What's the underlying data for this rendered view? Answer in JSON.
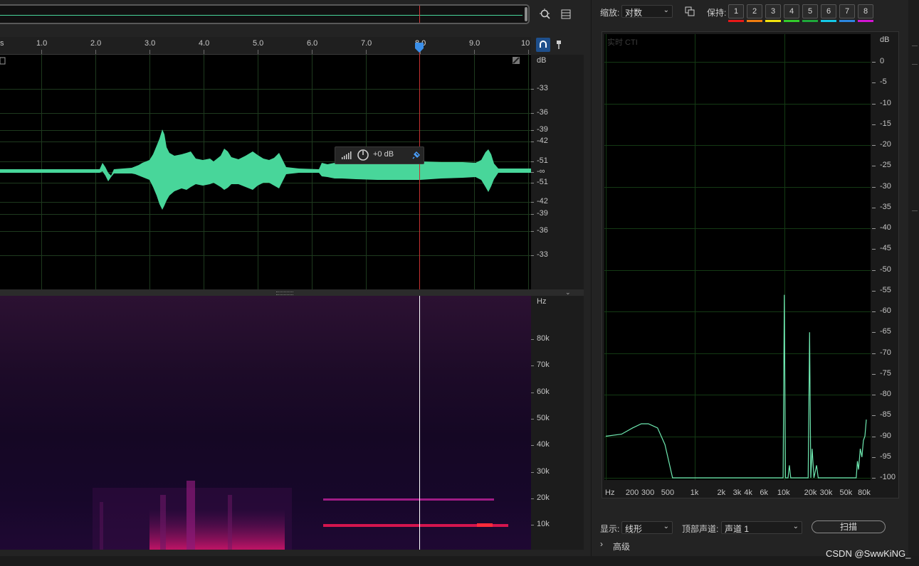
{
  "editor": {
    "ruler": {
      "start_label": "s",
      "ticks": [
        "1.0",
        "2.0",
        "3.0",
        "4.0",
        "5.0",
        "6.0",
        "7.0",
        "8.0",
        "9.0",
        "10"
      ]
    },
    "db_scale": {
      "unit": "dB",
      "labels": [
        "-33",
        "-36",
        "-39",
        "-42",
        "-51",
        "-∞",
        "-51",
        "-42",
        "-39",
        "-36",
        "-33"
      ]
    },
    "hud": {
      "gain": "+0 dB"
    },
    "hz_scale": {
      "unit": "Hz",
      "labels": [
        "80k",
        "70k",
        "60k",
        "50k",
        "40k",
        "30k",
        "20k",
        "10k"
      ]
    },
    "colors": {
      "waveform": "#48d69a",
      "cti": "#d23a3a",
      "grid": "#1e3a1e"
    },
    "icons": [
      "zoom-icon",
      "list-icon",
      "snap-icon",
      "marker-icon",
      "gain-meter-icon",
      "knob-icon",
      "pin-icon"
    ]
  },
  "frequency_analysis": {
    "zoom_label": "缩放:",
    "zoom_value": "对数",
    "hold_label": "保持:",
    "hold_buttons": [
      "1",
      "2",
      "3",
      "4",
      "5",
      "6",
      "7",
      "8"
    ],
    "hold_colors": [
      "#e81818",
      "#f07d10",
      "#f2e40e",
      "#33cc2b",
      "#1ea83a",
      "#14c8e6",
      "#2c86e0",
      "#d215d2"
    ],
    "plot_label": "实时 CTI",
    "display_label": "显示:",
    "display_value": "线形",
    "channel_label": "顶部声道:",
    "channel_value": "声道 1",
    "scan_label": "扫描",
    "advanced_label": "高级",
    "chart_data": {
      "type": "line",
      "xlabel": "Hz",
      "x_scale": "log",
      "x_tick_labels": [
        "Hz",
        "200",
        "300",
        "500",
        "1k",
        "2k",
        "3k",
        "4k",
        "6k",
        "10k",
        "20k",
        "30k",
        "50k",
        "80k"
      ],
      "x_tick_values": [
        100,
        200,
        300,
        500,
        1000,
        2000,
        3000,
        4000,
        6000,
        10000,
        20000,
        30000,
        50000,
        80000
      ],
      "ylabel": "dB",
      "y_tick_labels": [
        "dB",
        "0",
        "-5",
        "-10",
        "-15",
        "-20",
        "-25",
        "-30",
        "-35",
        "-40",
        "-45",
        "-50",
        "-55",
        "-60",
        "-65",
        "-70",
        "-75",
        "-80",
        "-85",
        "-90",
        "-95",
        "-100"
      ],
      "ylim": [
        -100,
        5
      ],
      "grid": true,
      "series": [
        {
          "color": "#6ee8b0",
          "points": [
            [
              100,
              -90
            ],
            [
              150,
              -89.5
            ],
            [
              200,
              -88
            ],
            [
              250,
              -87
            ],
            [
              300,
              -87
            ],
            [
              380,
              -88
            ],
            [
              460,
              -92
            ],
            [
              560,
              -100
            ],
            [
              9700,
              -100
            ],
            [
              10000,
              -56
            ],
            [
              10300,
              -100
            ],
            [
              11000,
              -100
            ],
            [
              11400,
              -97
            ],
            [
              11800,
              -100
            ],
            [
              18500,
              -100
            ],
            [
              19200,
              -65
            ],
            [
              19800,
              -100
            ],
            [
              20500,
              -93
            ],
            [
              21500,
              -100
            ],
            [
              23000,
              -97
            ],
            [
              24000,
              -100
            ],
            [
              64000,
              -100
            ],
            [
              66000,
              -96
            ],
            [
              68000,
              -98
            ],
            [
              71000,
              -93
            ],
            [
              74000,
              -95
            ],
            [
              77000,
              -91
            ],
            [
              80000,
              -90
            ],
            [
              83000,
              -86
            ]
          ]
        }
      ]
    }
  },
  "watermark": "CSDN @SwwKiNG_"
}
